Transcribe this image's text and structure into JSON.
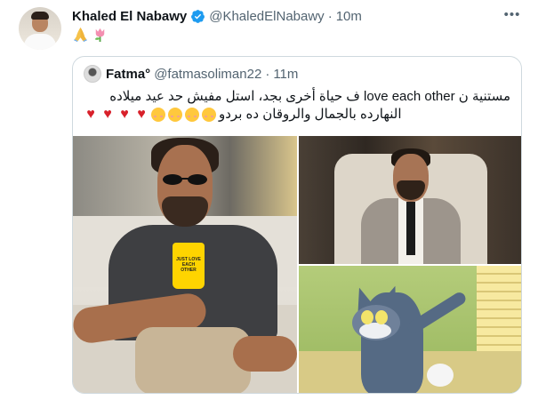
{
  "tweet": {
    "author_name": "Khaled El Nabawy",
    "author_handle": "@KhaledElNabawy",
    "separator": "·",
    "time": "10m",
    "more_label": "•••",
    "emojis": [
      "folded-hands-emoji",
      "tulip-emoji"
    ]
  },
  "quoted": {
    "author_name": "Fatma°",
    "author_handle": "@fatmasoliman22",
    "separator": "·",
    "time": "11m",
    "text_line1": "مستنية ن love each other ف حياة أخرى بجد، استل مفيش حد عيد ميلاده",
    "text_line2": "النهارده بالجمال والروقان ده بردو",
    "emoji_row": [
      "smiling-face-with-blush",
      "smiling-face-with-blush",
      "smiling-face-with-blush",
      "smiling-face-with-blush",
      "red-heart",
      "red-heart",
      "red-heart",
      "red-heart"
    ],
    "cup_text": "JUST LOVE EACH OTHER"
  },
  "colors": {
    "accent": "#1d9bf0",
    "text_primary": "#0f1419",
    "text_secondary": "#536471",
    "border": "#cfd9de"
  }
}
